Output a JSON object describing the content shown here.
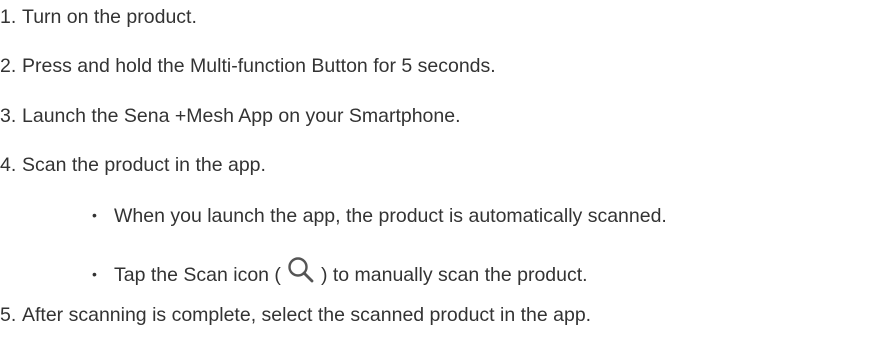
{
  "steps": [
    {
      "num": "1.",
      "text": "Turn on the product."
    },
    {
      "num": "2.",
      "text": "Press and hold the Multi-function Button for 5 seconds."
    },
    {
      "num": "3.",
      "text": "Launch the Sena +Mesh App on your Smartphone."
    },
    {
      "num": "4.",
      "text": "Scan the product in the app."
    },
    {
      "num": "5.",
      "text": "After scanning is complete, select the scanned product in the app."
    }
  ],
  "sub_items": [
    {
      "text": "When you launch the app, the product is automatically scanned."
    },
    {
      "text_before": "Tap the Scan icon (",
      "icon": "search-icon",
      "text_after": ") to manually scan the product."
    }
  ],
  "bullet_char": "•"
}
